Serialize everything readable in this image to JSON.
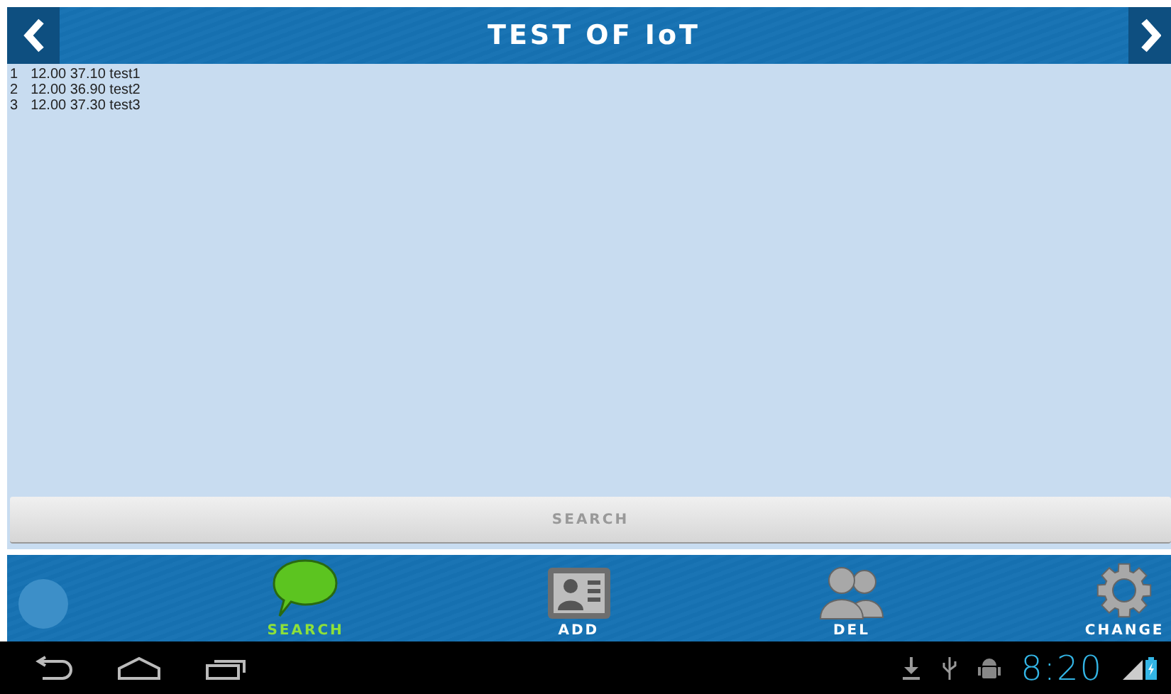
{
  "header": {
    "title": "TEST OF IoT"
  },
  "records": [
    {
      "index": "1",
      "text": "12.00 37.10 test1"
    },
    {
      "index": "2",
      "text": "12.00 36.90 test2"
    },
    {
      "index": "3",
      "text": "12.00 37.30 test3"
    }
  ],
  "search_button": {
    "label": "SEARCH"
  },
  "tabs": [
    {
      "kind": "chat",
      "label": "SEARCH",
      "selected": true
    },
    {
      "kind": "card",
      "label": "ADD",
      "selected": false
    },
    {
      "kind": "people",
      "label": "DEL",
      "selected": false
    },
    {
      "kind": "gear",
      "label": "CHANGE",
      "selected": false
    }
  ],
  "status_bar": {
    "time": "8:20"
  }
}
